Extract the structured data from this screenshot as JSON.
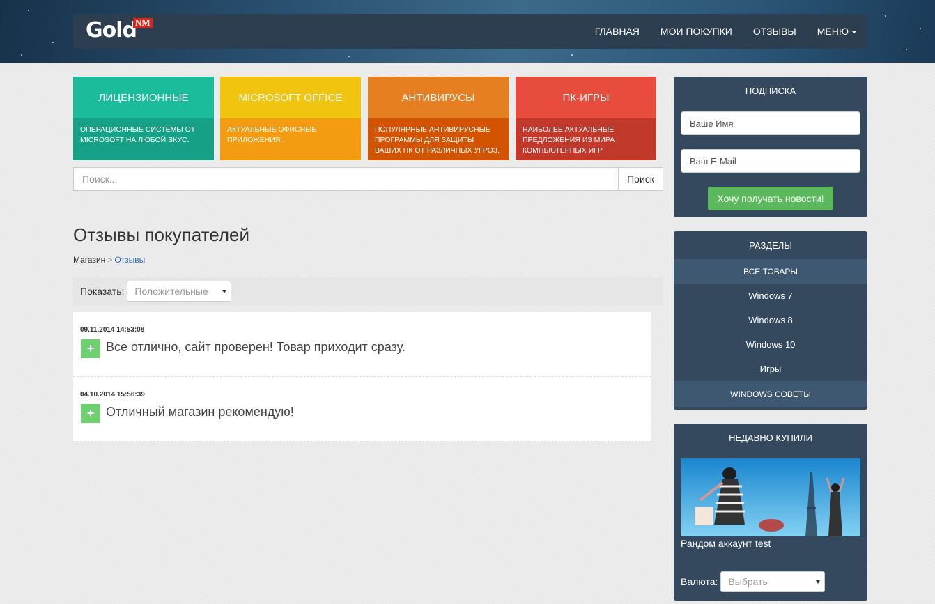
{
  "header": {
    "logo_text": "Gold",
    "logo_badge": "NM",
    "nav": [
      {
        "label": "Главная"
      },
      {
        "label": "Мои покупки"
      },
      {
        "label": "Отзывы"
      },
      {
        "label": "Меню"
      }
    ]
  },
  "tiles": [
    {
      "title": "Лицензионные",
      "desc": "Операционные системы от Microsoft на любой вкус.",
      "top_color": "#1abc9c",
      "bottom_color": "#16a085"
    },
    {
      "title": "Microsoft Office",
      "desc": "Актуальные офисные приложения..",
      "top_color": "#f1c40f",
      "bottom_color": "#f39c12"
    },
    {
      "title": "Антивирусы",
      "desc": "Популярные антивирусные программы для защиты ваших ПК от различных угроз.",
      "top_color": "#e67e22",
      "bottom_color": "#d35400"
    },
    {
      "title": "ПК-игры",
      "desc": "Наиболее актуальные предложения из мира компьютерных игр",
      "top_color": "#e74c3c",
      "bottom_color": "#c0392b"
    }
  ],
  "search": {
    "placeholder": "Поиск...",
    "button": "Поиск"
  },
  "main": {
    "title": "Отзывы покупателей",
    "breadcrumb": {
      "home": "Магазин",
      "separator": ">",
      "current": "Отзывы"
    },
    "filter": {
      "label": "Показать:",
      "selected": "Положительные"
    },
    "reviews": [
      {
        "date": "09.11.2014 14:53:08",
        "sign": "+",
        "text": "Все отлично, сайт проверен! Товар приходит сразу."
      },
      {
        "date": "04.10.2014 15:56:39",
        "sign": "+",
        "text": "Отличный магазин рекомендую!"
      }
    ]
  },
  "sidebar": {
    "subscribe": {
      "title": "Подписка",
      "name_placeholder": "Ваше Имя",
      "email_placeholder": "Ваш E-Mail",
      "button": "Хочу получать новости!"
    },
    "sections": {
      "title": "Разделы",
      "items": [
        {
          "label": "Все товары"
        },
        {
          "label": "Windows 7"
        },
        {
          "label": "Windows 8"
        },
        {
          "label": "Windows 10"
        },
        {
          "label": "Игры"
        },
        {
          "label": "Windows советы"
        }
      ]
    },
    "recent": {
      "title": "Недавно купили",
      "caption": "Рандом аккаунт test",
      "currency_label": "Валюта:",
      "currency_selected": "Выбрать"
    }
  }
}
